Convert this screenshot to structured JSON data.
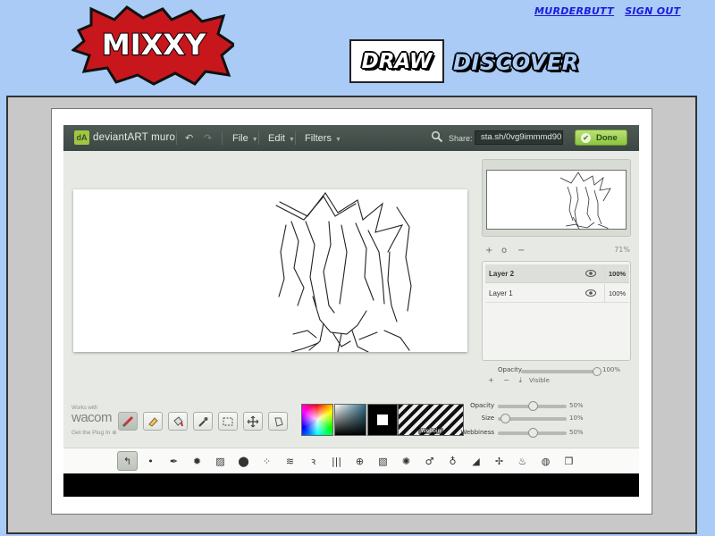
{
  "site": {
    "logo_text": "MIXXY",
    "user_name": "MURDERBUTT",
    "sign_out": "SIGN OUT",
    "nav_draw": "DRAW",
    "nav_discover": "DISCOVER"
  },
  "muro": {
    "brand": "deviantART muro",
    "menus": {
      "file": "File",
      "edit": "Edit",
      "filters": "Filters"
    },
    "share_label": "Share:",
    "share_value": "sta.sh/0vg9immmd90",
    "done_label": "Done",
    "zoom_level": "71%",
    "zoom_plus": "+",
    "zoom_reset": "o",
    "zoom_minus": "−",
    "layers": [
      {
        "name": "Layer 2",
        "opacity": "100%",
        "selected": true
      },
      {
        "name": "Layer 1",
        "opacity": "100%",
        "selected": false
      }
    ],
    "layer_opacity_label": "Opacity",
    "layer_opacity_value": "100%",
    "layer_add": "+",
    "layer_remove": "−",
    "layer_visible": "Visible",
    "wacom": {
      "works_with": "Works with",
      "logo": "wacom",
      "plugin": "Get the Plug In"
    },
    "texture_label": "Webbin",
    "sliders": [
      {
        "label": "Opacity",
        "value": "50%",
        "fraction": 0.5
      },
      {
        "label": "Size",
        "value": "10%",
        "fraction": 0.1
      },
      {
        "label": "Webbiness",
        "value": "50%",
        "fraction": 0.5
      }
    ]
  },
  "colors": {
    "page_bg": "#a9cbf5",
    "logo_red": "#c8161d",
    "link_blue": "#1c1ce0",
    "topbar_dark": "#444e4a",
    "done_green": "#8cc63f",
    "active_color": "#000000"
  }
}
